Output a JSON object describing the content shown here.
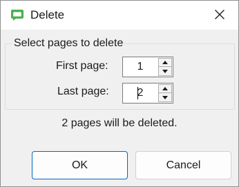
{
  "window": {
    "title": "Delete",
    "accent": "#0067c0"
  },
  "icons": {
    "app": "speech-bubble-icon",
    "close": "close-icon",
    "up": "spin-up-icon",
    "down": "spin-down-icon"
  },
  "group": {
    "legend": "Select pages to delete",
    "first_page": {
      "label": "First page:",
      "value": "1"
    },
    "last_page": {
      "label": "Last page:",
      "value": "2"
    }
  },
  "message": "2 pages will be deleted.",
  "buttons": {
    "ok": "OK",
    "cancel": "Cancel"
  }
}
